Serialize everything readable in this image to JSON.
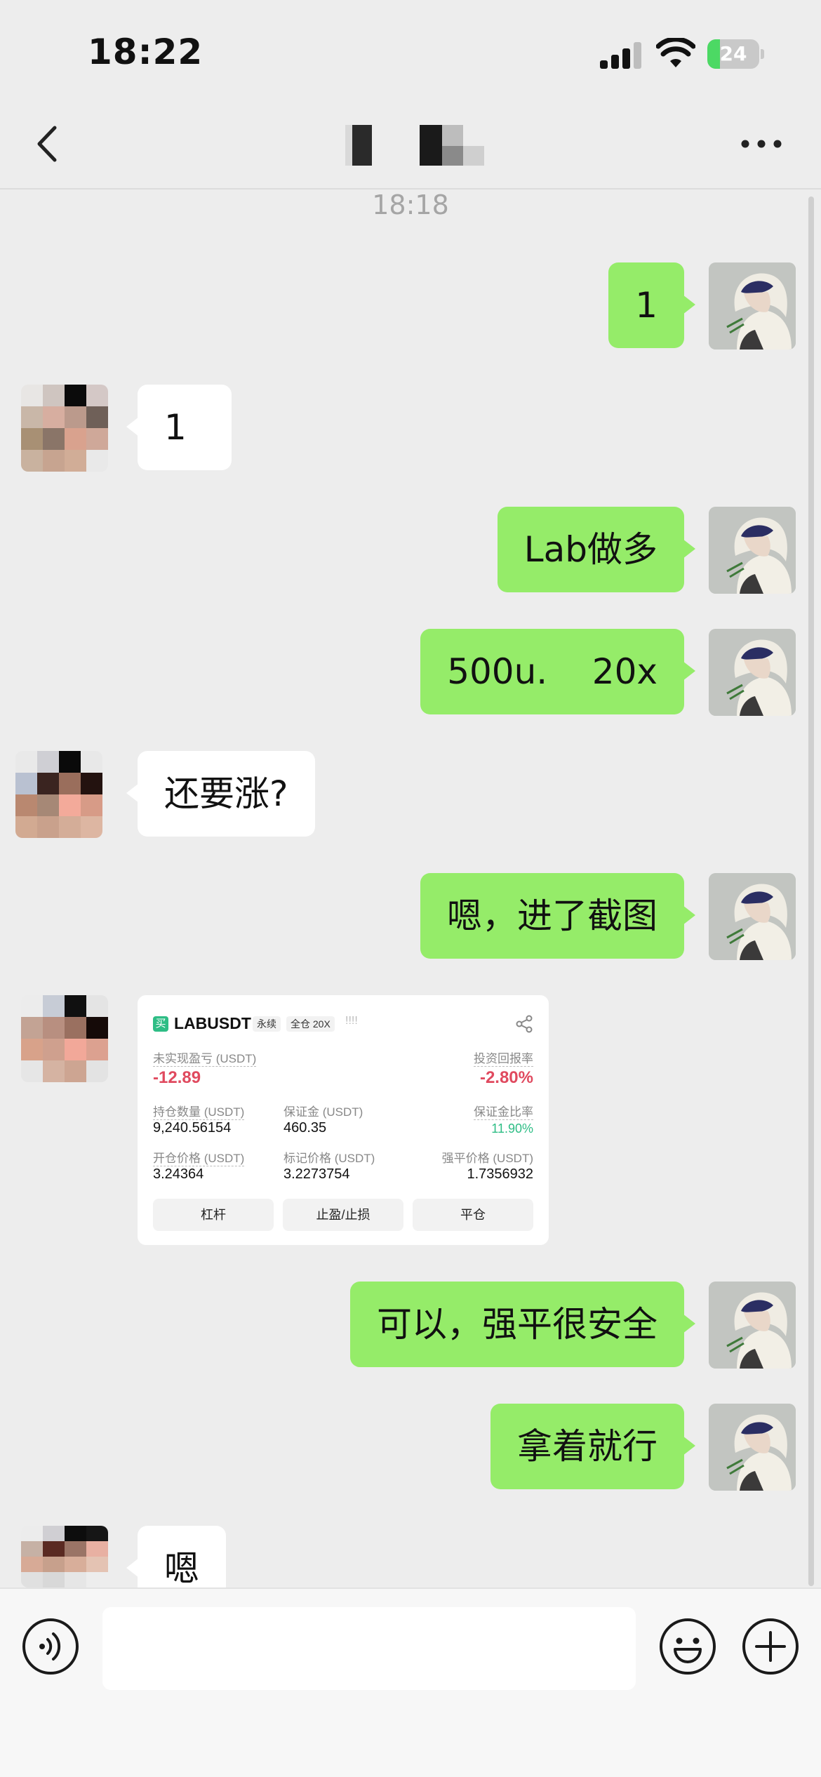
{
  "status_bar": {
    "time": "18:22",
    "battery": "24",
    "battery_level": 0.24
  },
  "header": {
    "back_icon": "chevron-left-icon",
    "more_icon": "more-dots-icon"
  },
  "chat": {
    "timestamp": "18:18",
    "messages": [
      {
        "sender": "me",
        "text": "1"
      },
      {
        "sender": "them",
        "text": "1"
      },
      {
        "sender": "me",
        "text": "Lab做多"
      },
      {
        "sender": "me",
        "text": "500u.    20x"
      },
      {
        "sender": "them",
        "text": "还要涨?"
      },
      {
        "sender": "me",
        "text": "嗯，进了截图"
      },
      {
        "sender": "them",
        "type": "image"
      },
      {
        "sender": "me",
        "text": "可以，强平很安全"
      },
      {
        "sender": "me",
        "text": "拿着就行"
      },
      {
        "sender": "them",
        "text": "嗯"
      }
    ]
  },
  "position_card": {
    "buy_tag": "买",
    "symbol": "LABUSDT",
    "tag_perpetual": "永续",
    "tag_margin": "全仓 20X",
    "tag_bars": "!!!!",
    "unrealized_pnl_label": "未实现盈亏 (USDT)",
    "unrealized_pnl": "-12.89",
    "roi_label": "投资回报率",
    "roi": "-2.80%",
    "position_size_label": "持仓数量 (USDT)",
    "position_size": "9,240.56154",
    "margin_label": "保证金 (USDT)",
    "margin": "460.35",
    "margin_ratio_label": "保证金比率",
    "margin_ratio": "11.90%",
    "entry_price_label": "开仓价格 (USDT)",
    "entry_price": "3.24364",
    "mark_price_label": "标记价格 (USDT)",
    "mark_price": "3.2273754",
    "liq_price_label": "强平价格 (USDT)",
    "liq_price": "1.7356932",
    "btn_leverage": "杠杆",
    "btn_tpsl": "止盈/止损",
    "btn_close": "平仓"
  },
  "input_bar": {
    "placeholder": "",
    "voice_icon": "voice-icon",
    "emoji_icon": "emoji-icon",
    "plus_icon": "plus-icon"
  },
  "colors": {
    "my_bubble": "#95ec69",
    "their_bubble": "#ffffff",
    "background": "#ededed",
    "negative": "#e04a5f",
    "positive": "#2ebd85"
  }
}
